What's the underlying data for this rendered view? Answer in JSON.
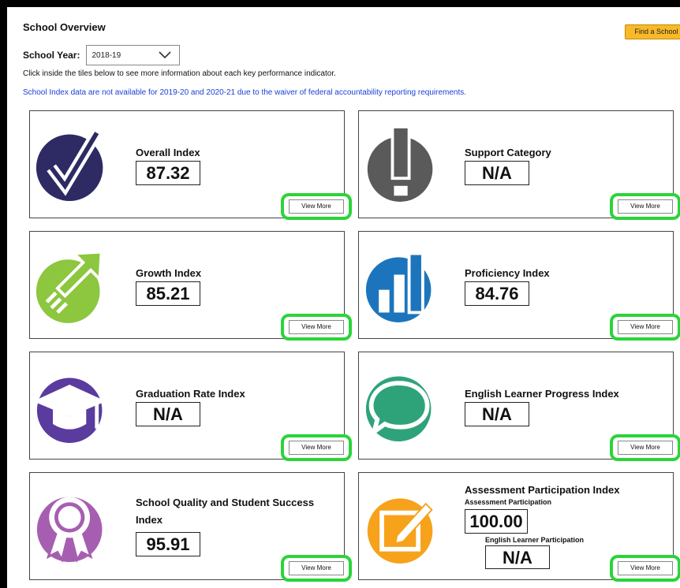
{
  "header": {
    "title": "School Overview",
    "find_button": "Find a School",
    "year_label": "School Year:",
    "year_value": "2018-19",
    "instructions": "Click inside the tiles below to see more information about each key performance indicator.",
    "notice": "School Index data are not available for 2019-20 and 2020-21 due to the waiver of federal accountability reporting requirements."
  },
  "colors": {
    "accent_button": "#f9b928",
    "highlight_green": "#2bd43a",
    "notice_blue": "#1a3fd6",
    "overall_icon": "#2d2a64",
    "support_icon": "#5a5a5a",
    "growth_icon": "#8dc63f",
    "proficiency_icon": "#1c75bc",
    "graduation_icon": "#5a3b9e",
    "el_progress_icon": "#2ea37a",
    "sqss_icon": "#a65fb0",
    "assessment_icon": "#f7a21b"
  },
  "tiles": [
    {
      "title": "Overall Index",
      "value": "87.32",
      "icon": "checkmark-icon",
      "view_more": "View More"
    },
    {
      "title": "Support Category",
      "value": "N/A",
      "icon": "exclamation-icon",
      "view_more": "View More"
    },
    {
      "title": "Growth Index",
      "value": "85.21",
      "icon": "growth-arrow-icon",
      "view_more": "View More"
    },
    {
      "title": "Proficiency Index",
      "value": "84.76",
      "icon": "bar-chart-icon",
      "view_more": "View More"
    },
    {
      "title": "Graduation Rate Index",
      "value": "N/A",
      "icon": "graduation-cap-icon",
      "view_more": "View More"
    },
    {
      "title": "English Learner Progress Index",
      "value": "N/A",
      "icon": "speech-bubble-icon",
      "view_more": "View More"
    },
    {
      "title": "School Quality and Student Success Index",
      "value": "95.91",
      "icon": "award-ribbon-icon",
      "view_more": "View More"
    },
    {
      "title": "Assessment Participation Index",
      "sub1_label": "Assessment Participation",
      "value": "100.00",
      "sub2_label": "English Learner Participation",
      "value2": "N/A",
      "icon": "edit-pencil-icon",
      "view_more": "View More"
    }
  ]
}
